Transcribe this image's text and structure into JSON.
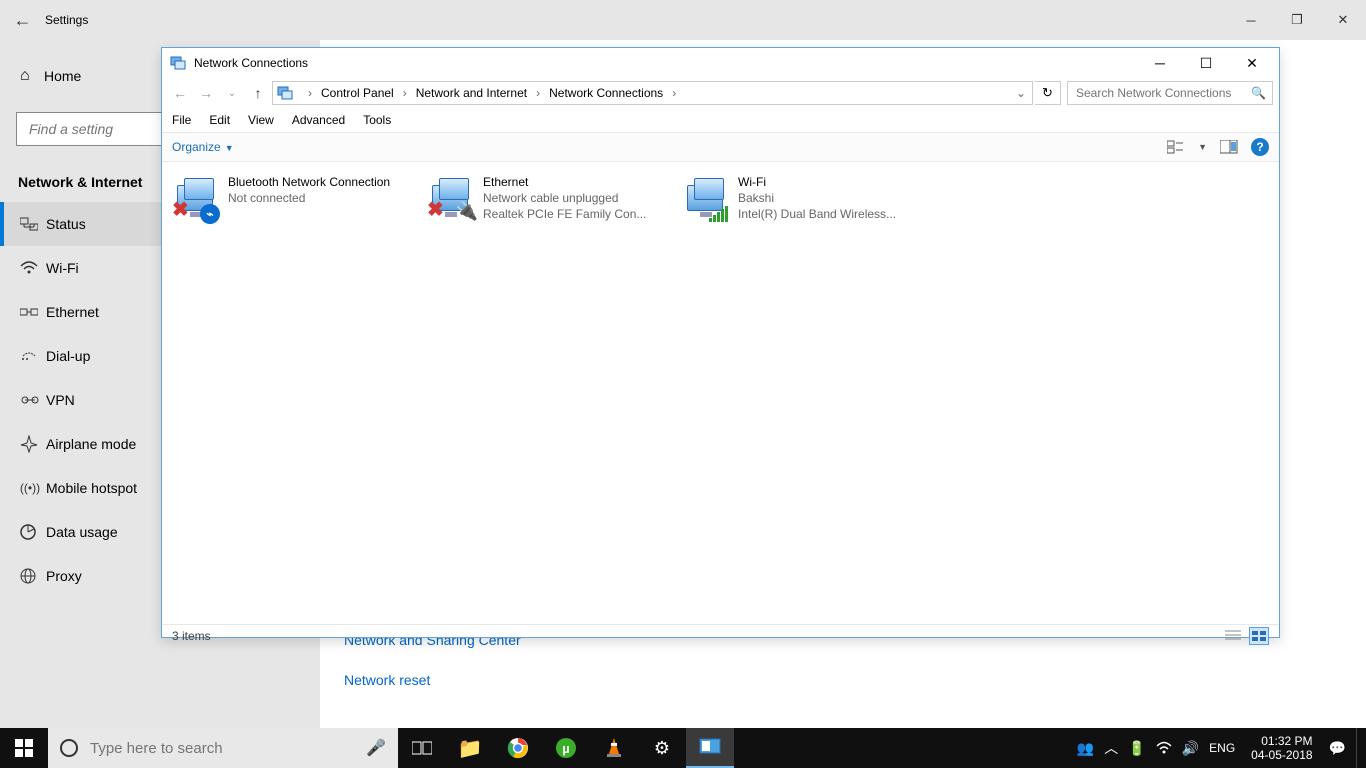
{
  "settings": {
    "title": "Settings",
    "home": "Home",
    "search_placeholder": "Find a setting",
    "section": "Network & Internet",
    "items": [
      {
        "icon": "status",
        "label": "Status"
      },
      {
        "icon": "wifi",
        "label": "Wi-Fi"
      },
      {
        "icon": "ethernet",
        "label": "Ethernet"
      },
      {
        "icon": "dialup",
        "label": "Dial-up"
      },
      {
        "icon": "vpn",
        "label": "VPN"
      },
      {
        "icon": "airplane",
        "label": "Airplane mode"
      },
      {
        "icon": "hotspot",
        "label": "Mobile hotspot"
      },
      {
        "icon": "data",
        "label": "Data usage"
      },
      {
        "icon": "proxy",
        "label": "Proxy"
      }
    ],
    "selected_index": 0,
    "links": {
      "sharing": "Network and Sharing Center",
      "reset": "Network reset"
    }
  },
  "explorer": {
    "title": "Network Connections",
    "breadcrumbs": [
      "Control Panel",
      "Network and Internet",
      "Network Connections"
    ],
    "search_placeholder": "Search Network Connections",
    "menu": [
      "File",
      "Edit",
      "View",
      "Advanced",
      "Tools"
    ],
    "toolbar_organize": "Organize",
    "connections": [
      {
        "name": "Bluetooth Network Connection",
        "l2": "Not connected",
        "l3": "",
        "status": "error",
        "overlay": "bluetooth"
      },
      {
        "name": "Ethernet",
        "l2": "Network cable unplugged",
        "l3": "Realtek PCIe FE Family Con...",
        "status": "error",
        "overlay": "cable"
      },
      {
        "name": "Wi-Fi",
        "l2": "Bakshi",
        "l3": "Intel(R) Dual Band Wireless...",
        "status": "ok",
        "overlay": "bars"
      }
    ],
    "status_text": "3 items"
  },
  "taskbar": {
    "search_placeholder": "Type here to search",
    "lang": "ENG",
    "time": "01:32 PM",
    "date": "04-05-2018"
  }
}
